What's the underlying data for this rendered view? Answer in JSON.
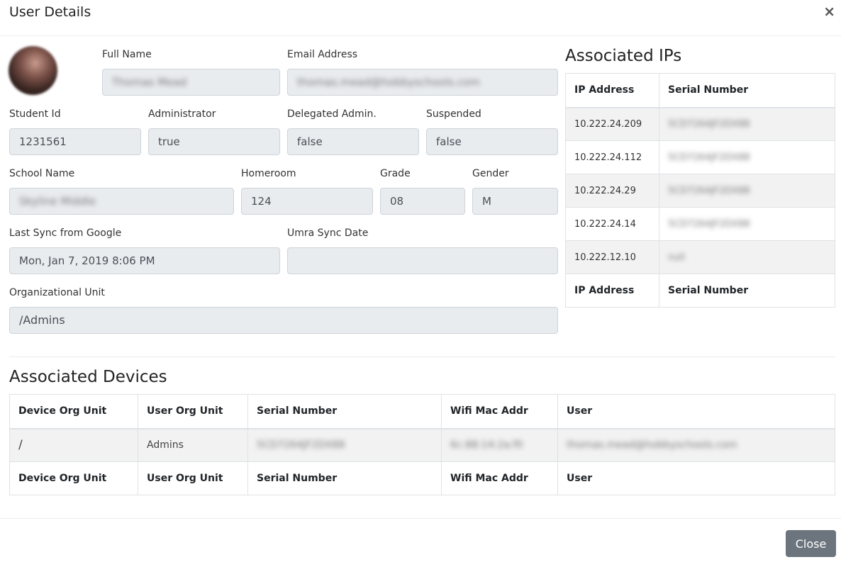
{
  "modal": {
    "title": "User Details",
    "close_icon": "×"
  },
  "profile": {
    "full_name_label": "Full Name",
    "full_name": "Thomas Mead",
    "email_label": "Email Address",
    "email": "thomas.mead@hobbyschools.com",
    "student_id_label": "Student Id",
    "student_id": "1231561",
    "administrator_label": "Administrator",
    "administrator": "true",
    "delegated_label": "Delegated Admin.",
    "delegated": "false",
    "suspended_label": "Suspended",
    "suspended": "false",
    "school_label": "School Name",
    "school": "Skyline Middle",
    "homeroom_label": "Homeroom",
    "homeroom": "124",
    "grade_label": "Grade",
    "grade": "08",
    "gender_label": "Gender",
    "gender": "M",
    "last_sync_label": "Last Sync from Google",
    "last_sync": "Mon, Jan 7, 2019 8:06 PM",
    "umra_label": "Umra Sync Date",
    "umra": "",
    "org_unit_label": "Organizational Unit",
    "org_unit": "/Admins"
  },
  "ips": {
    "title": "Associated IPs",
    "headers": [
      "IP Address",
      "Serial Number"
    ],
    "rows": [
      [
        "10.222.24.209",
        "5CD7264JF2DX88"
      ],
      [
        "10.222.24.112",
        "5CD7264JF2DX88"
      ],
      [
        "10.222.24.29",
        "5CD7264JF2DX88"
      ],
      [
        "10.222.24.14",
        "5CD7264JF2DX88"
      ],
      [
        "10.222.12.10",
        "null"
      ]
    ]
  },
  "devices": {
    "title": "Associated Devices",
    "headers": [
      "Device Org Unit",
      "User Org Unit",
      "Serial Number",
      "Wifi Mac Addr",
      "User"
    ],
    "rows": [
      [
        "/",
        "Admins",
        "5CD7264JF2DX88",
        "6c:88:14:2a:f0",
        "thomas.mead@hobbyschools.com"
      ]
    ]
  },
  "footer": {
    "close_label": "Close"
  }
}
